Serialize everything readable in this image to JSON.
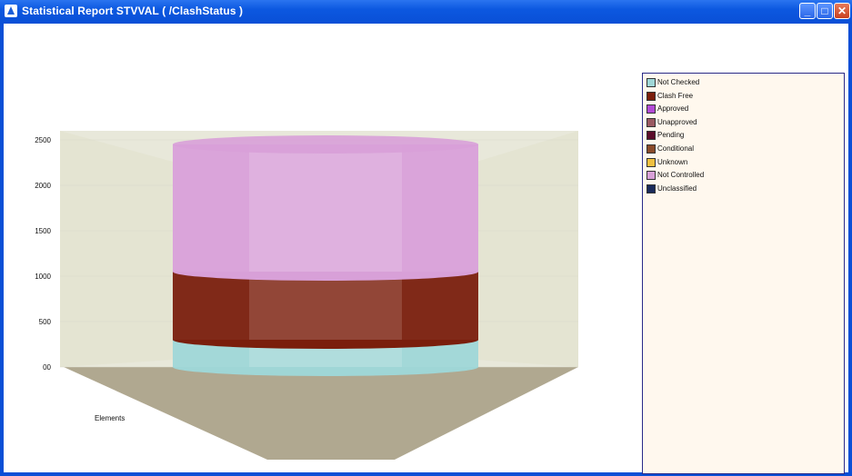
{
  "window": {
    "title": "Statistical Report STVVAL ( /ClashStatus )",
    "buttons": {
      "minimize": "_",
      "maximize": "□",
      "close": "✕"
    }
  },
  "chart_data": {
    "type": "bar",
    "style": "3d-cylinder-stacked",
    "categories": [
      "Elements"
    ],
    "xlabel": "Elements",
    "ylabel": "",
    "ylim": [
      0,
      2500
    ],
    "yticks": [
      "00",
      "500",
      "1000",
      "1500",
      "2000",
      "2500"
    ],
    "series": [
      {
        "name": "Not Checked",
        "values": [
          300
        ],
        "color": "#9fd6d6"
      },
      {
        "name": "Clash Free",
        "values": [
          750
        ],
        "color": "#7a1e0c"
      },
      {
        "name": "Approved",
        "values": [
          0
        ],
        "color": "#b24ad6"
      },
      {
        "name": "Unapproved",
        "values": [
          0
        ],
        "color": "#9a5a62"
      },
      {
        "name": "Pending",
        "values": [
          0
        ],
        "color": "#5a0c2a"
      },
      {
        "name": "Conditional",
        "values": [
          0
        ],
        "color": "#8a4a2a"
      },
      {
        "name": "Unknown",
        "values": [
          0
        ],
        "color": "#f0c040"
      },
      {
        "name": "Not Controlled",
        "values": [
          1400
        ],
        "color": "#d8a0d8"
      },
      {
        "name": "Unclassified",
        "values": [
          0
        ],
        "color": "#1a2a5a"
      }
    ],
    "legend_position": "right",
    "grid": true
  },
  "colors": {
    "titlebar": "#0a4fd6",
    "legend_bg": "#fff8ee",
    "legend_border": "#2a2a88",
    "wall": "#e6e6d6",
    "floor": "#b0a890"
  }
}
